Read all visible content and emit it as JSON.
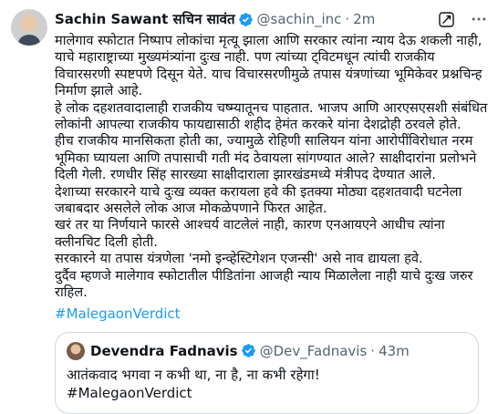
{
  "tweet": {
    "author_name": "Sachin Sawant सचिन सावंत",
    "handle": "@sachin_inc",
    "separator": "·",
    "time": "2m",
    "paragraphs": [
      "मालेगाव स्फोटात निष्पाप लोकांचा मृत्यू झाला आणि सरकार त्यांना न्याय देऊ शकली नाही, याचे महाराष्ट्राच्या मुख्यमंत्र्यांना दुःख नाही. पण त्यांच्या ट्विटमधून त्यांची राजकीय विचारसरणी स्पष्टपणे दिसून येते. याच विचारसरणीमुळे तपास यंत्रणांच्या भूमिकेवर प्रश्नचिन्ह निर्माण झाले आहे.",
      "हे लोक दहशतवादालाही राजकीय चष्म्यातूनच पाहतात. भाजप आणि आरएसएसशी संबंधित लोकांनी आपल्या राजकीय फायद्यासाठी शहीद हेमंत करकरे यांना देशद्रोही ठरवले होते.",
      "हीच राजकीय मानसिकता होती का, ज्यामुळे रोहिणी सालियन यांना आरोपींविरोधात नरम भूमिका घ्यायला आणि तपासाची गती मंद ठेवायला सांगण्यात आले? साक्षीदारांना प्रलोभने दिली गेली. रणधीर सिंह सारख्या साक्षीदाराला झारखंडमध्ये मंत्रीपद देण्यात आले.",
      " देशाच्या सरकारने याचे दुःख व्यक्त करायला हवे की इतक्या मोठ्या दहशतवादी घटनेला जबाबदार असलेले लोक आज मोकळेपणाने फिरत आहेत.",
      "खरं तर या निर्णयाने फारसे आश्चर्य वाटलेलं नाही, कारण एनआयएने आधीच त्यांना क्लीनचिट दिली होती.",
      "सरकारने या तपास यंत्रणेला 'नमो इन्व्हेस्टिगेशन एजन्सी' असे नाव द्यायला हवे.",
      "दुर्दैव म्हणजे मालेगाव स्फोटातील पीडितांना आजही न्याय मिळालेला नाही याचे दुःख जरुर राहिल."
    ],
    "hashtag": "#MalegaonVerdict",
    "quoted": {
      "author_name": "Devendra Fadnavis",
      "handle": "@Dev_Fadnavis",
      "separator": "·",
      "time": "43m",
      "text": "आतंकवाद भगवा न कभी था, ना है, ना कभी रहेगा!",
      "hashtag": "#MalegaonVerdict"
    }
  },
  "icons": {
    "verified": "verified-badge-icon",
    "grok": "grok-icon",
    "more": "more-options-icon"
  },
  "colors": {
    "accent": "#1d9bf0",
    "secondary_text": "#536471",
    "border": "#cfd9de"
  }
}
